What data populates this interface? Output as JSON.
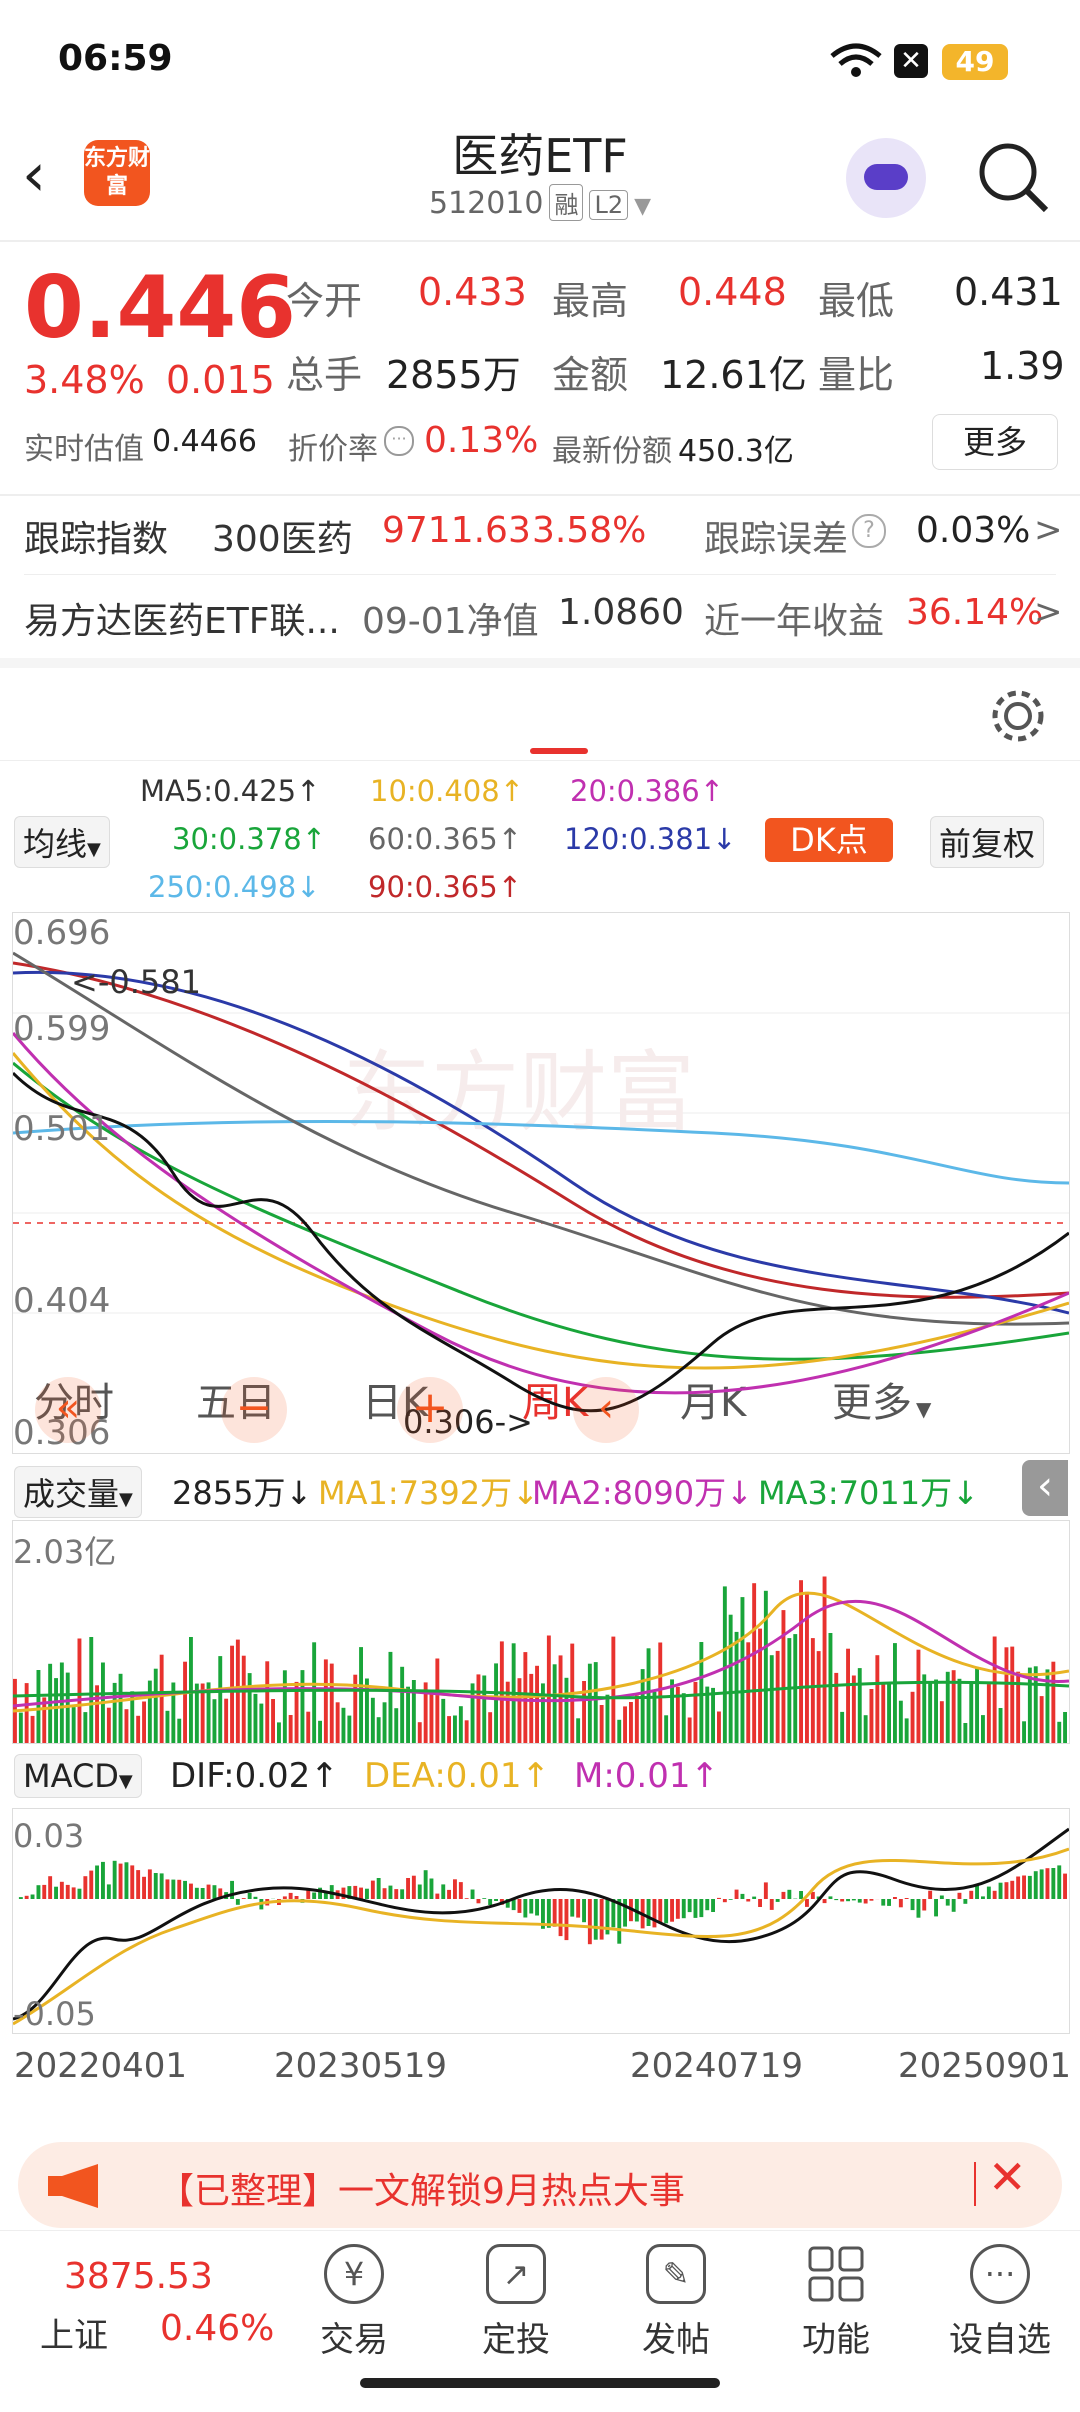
{
  "status": {
    "time": "06:59",
    "battery": "49"
  },
  "header": {
    "logo_text": "东方财富",
    "title": "医药ETF",
    "code": "512010",
    "tag_rong": "融",
    "tag_level": "L2"
  },
  "quote": {
    "price": "0.446",
    "change_pct": "3.48%",
    "change": "0.015",
    "open_label": "今开",
    "open": "0.433",
    "high_label": "最高",
    "high": "0.448",
    "low_label": "最低",
    "low": "0.431",
    "vol_label": "总手",
    "vol": "2855万",
    "amt_label": "金额",
    "amt": "12.61亿",
    "ratio_label": "量比",
    "ratio": "1.39",
    "iopv_label": "实时估值",
    "iopv": "0.4466",
    "premium_label": "折价率",
    "premium": "0.13%",
    "shares_label": "最新份额",
    "shares": "450.3亿",
    "more_label": "更多"
  },
  "tracking": {
    "index_label": "跟踪指数",
    "index_name": "300医药",
    "index_value": "9711.63",
    "index_pct": "3.58%",
    "err_label": "跟踪误差",
    "err_value": "0.03%",
    "fund_name": "易方达医药ETF联...",
    "nav_label": "09-01净值",
    "nav_value": "1.0860",
    "yr_label": "近一年收益",
    "yr_value": "36.14%"
  },
  "tabs": [
    "分时",
    "五日",
    "日K",
    "周K",
    "月K",
    "更多"
  ],
  "active_tab": "周K",
  "ma": {
    "selector": "均线",
    "ma5": "MA5:0.425↑",
    "ma10": "10:0.408↑",
    "ma20": "20:0.386↑",
    "ma30": "30:0.378↑",
    "ma60": "60:0.365↑",
    "ma120": "120:0.381↓",
    "ma250": "250:0.498↓",
    "ma90": "90:0.365↑",
    "dk": "DK点",
    "adjust": "前复权"
  },
  "kchart": {
    "y_ticks": [
      "0.696",
      "0.599",
      "0.501",
      "0.404",
      "0.306"
    ],
    "high_mark": "<-0.581",
    "low_mark": "0.306->",
    "watermark": "东方财富"
  },
  "volume": {
    "selector": "成交量",
    "value": "2855万↓",
    "ma1": "MA1:7392万↓",
    "ma2": "MA2:8090万↓",
    "ma3": "MA3:7011万↓",
    "max": "2.03亿"
  },
  "macd": {
    "selector": "MACD",
    "dif": "DIF:0.02↑",
    "dea": "DEA:0.01↑",
    "m": "M:0.01↑",
    "top": "0.03",
    "bottom": "-0.05"
  },
  "x_dates": [
    "20220401",
    "20230519",
    "20240719",
    "20250901"
  ],
  "banner": {
    "text": "【已整理】一文解锁9月热点大事"
  },
  "bottom_nav": {
    "index_value": "3875.53",
    "index_name": "上证",
    "index_pct": "0.46%",
    "items": [
      "交易",
      "定投",
      "发帖",
      "功能",
      "设自选"
    ]
  },
  "colors": {
    "up": "#e8322e",
    "down": "#19a53a",
    "accent": "#f2551f"
  }
}
